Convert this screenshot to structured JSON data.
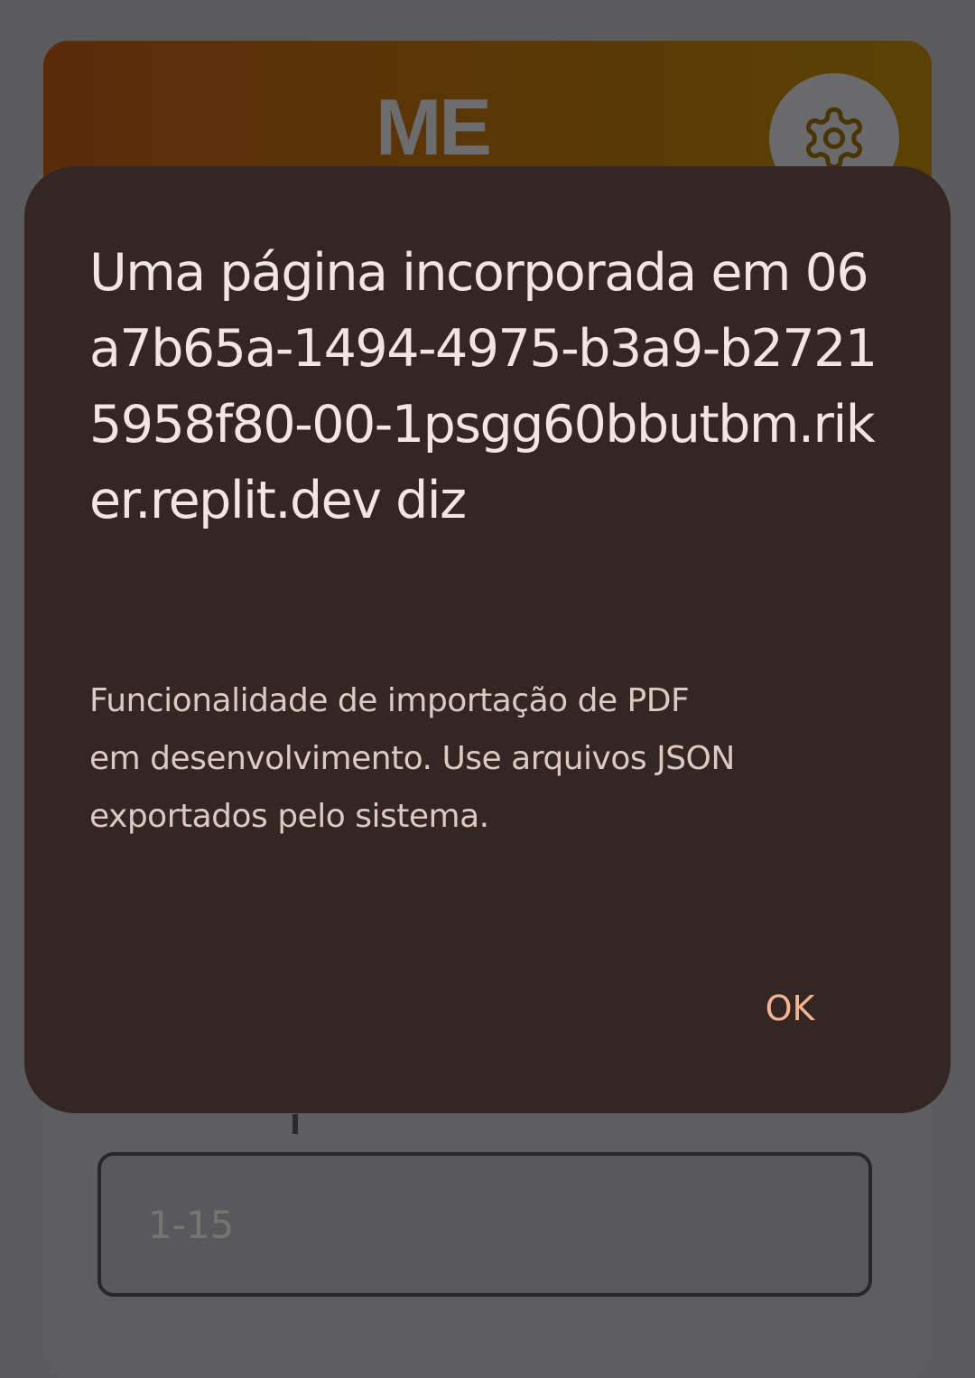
{
  "app": {
    "logo_text": "ME",
    "settings_icon": "gear-icon",
    "range_input": {
      "value": "",
      "placeholder": "1-15"
    }
  },
  "dialog": {
    "title": "Uma página incorporada em 06a7b65a-1494-4975-b3a9-b27215958f80-00-1psgg60bbutbm.riker.replit.dev diz",
    "message_lines": [
      "Funcionalidade de importação de PDF",
      "em desenvolvimento. Use arquivos JSON",
      "exportados pelo sistema."
    ],
    "ok_label": "OK"
  },
  "colors": {
    "dialog_background": "#342723",
    "dialog_text": "#f3e6e2",
    "button_accent": "#f4b48f",
    "scrim": "#5b5b5d"
  }
}
